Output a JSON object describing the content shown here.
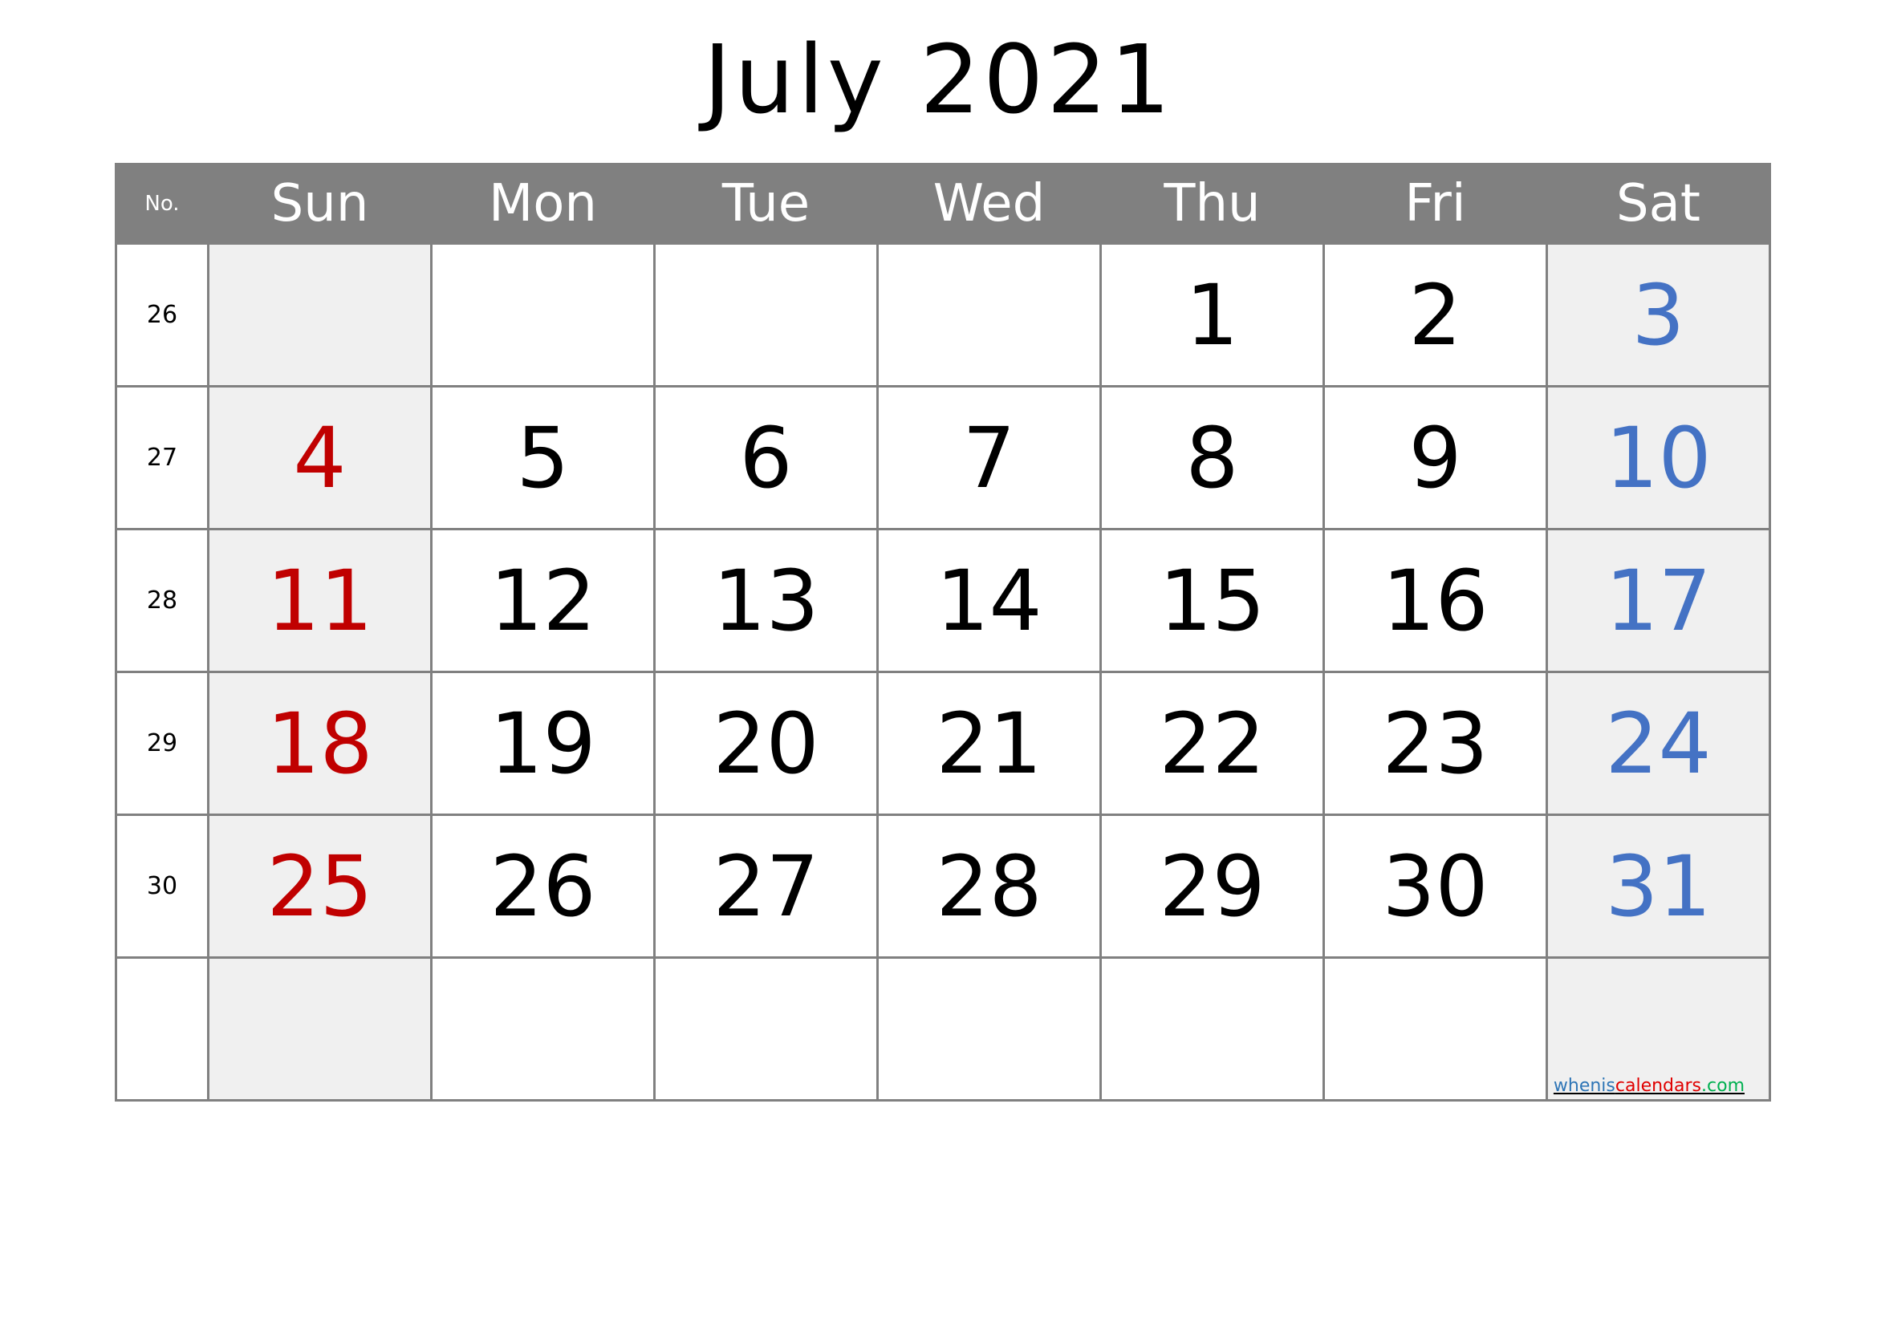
{
  "title": "July 2021",
  "header": {
    "no_label": "No.",
    "days": [
      "Sun",
      "Mon",
      "Tue",
      "Wed",
      "Thu",
      "Fri",
      "Sat"
    ]
  },
  "colors": {
    "sunday": "#c00000",
    "saturday": "#4472c4",
    "header_bg": "#808080",
    "weekend_bg": "#f0f0f0"
  },
  "weeks": [
    {
      "no": "26",
      "days": [
        "",
        "",
        "",
        "",
        "1",
        "2",
        "3"
      ]
    },
    {
      "no": "27",
      "days": [
        "4",
        "5",
        "6",
        "7",
        "8",
        "9",
        "10"
      ]
    },
    {
      "no": "28",
      "days": [
        "11",
        "12",
        "13",
        "14",
        "15",
        "16",
        "17"
      ]
    },
    {
      "no": "29",
      "days": [
        "18",
        "19",
        "20",
        "21",
        "22",
        "23",
        "24"
      ]
    },
    {
      "no": "30",
      "days": [
        "25",
        "26",
        "27",
        "28",
        "29",
        "30",
        "31"
      ]
    },
    {
      "no": "",
      "days": [
        "",
        "",
        "",
        "",
        "",
        "",
        ""
      ]
    }
  ],
  "watermark": {
    "part1": "whenis",
    "part2": "calendars",
    "part3": ".com"
  }
}
